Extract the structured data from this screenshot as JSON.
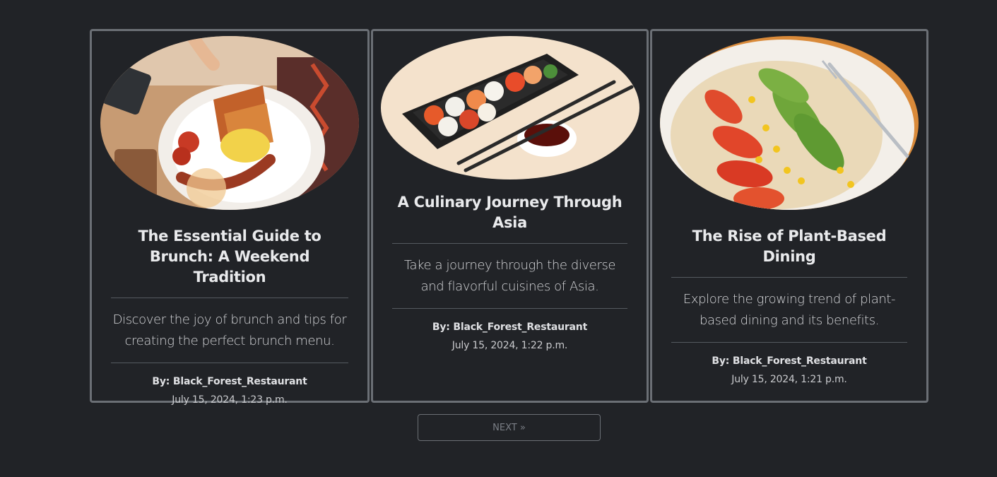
{
  "posts": [
    {
      "title": "The Essential Guide to Brunch: A Weekend Tradition",
      "description": "Discover the joy of brunch and tips for creating the perfect brunch menu.",
      "author": "By: Black_Forest_Restaurant",
      "date": "July 15, 2024, 1:23 p.m."
    },
    {
      "title": "A Culinary Journey Through Asia",
      "description": "Take a journey through the diverse and flavorful cuisines of Asia.",
      "author": "By: Black_Forest_Restaurant",
      "date": "July 15, 2024, 1:22 p.m."
    },
    {
      "title": "The Rise of Plant-Based Dining",
      "description": "Explore the growing trend of plant-based dining and its benefits.",
      "author": "By: Black_Forest_Restaurant",
      "date": "July 15, 2024, 1:21 p.m."
    }
  ],
  "pagination": {
    "next_label": "NEXT »"
  },
  "colors": {
    "background": "#212327",
    "card_border": "#6b6f75",
    "text": "#e9eaec"
  }
}
